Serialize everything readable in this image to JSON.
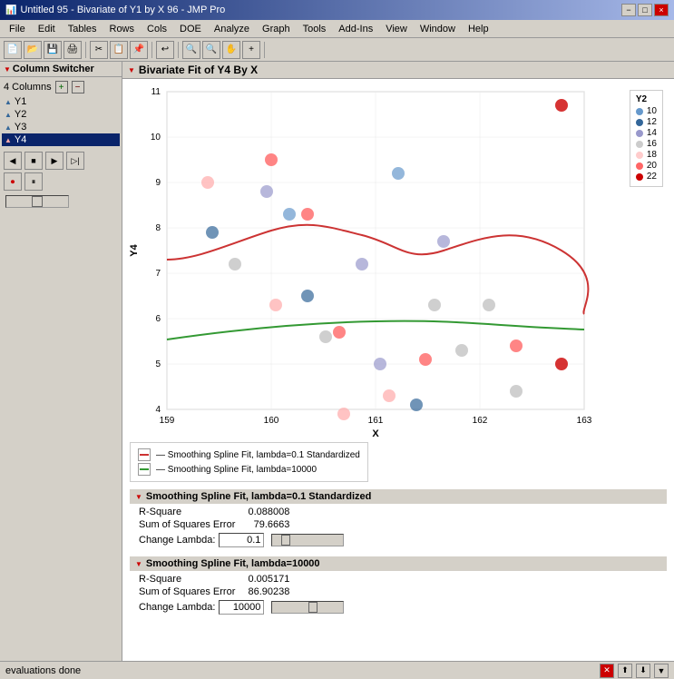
{
  "titleBar": {
    "title": "Untitled 95 - Bivariate of Y1 by X 96 - JMP Pro",
    "minBtn": "−",
    "maxBtn": "□",
    "closeBtn": "×"
  },
  "menuBar": {
    "items": [
      "File",
      "Edit",
      "Tables",
      "Rows",
      "Cols",
      "DOE",
      "Analyze",
      "Graph",
      "Tools",
      "Add-Ins",
      "View",
      "Window",
      "Help"
    ]
  },
  "leftPanel": {
    "header": "Column Switcher",
    "columnCount": "4 Columns",
    "addBtn": "+",
    "removeBtn": "−",
    "columns": [
      {
        "name": "Y1",
        "type": "numeric"
      },
      {
        "name": "Y2",
        "type": "numeric"
      },
      {
        "name": "Y3",
        "type": "numeric"
      },
      {
        "name": "Y4",
        "type": "numeric",
        "selected": true
      }
    ]
  },
  "chartHeader": "Bivariate Fit of Y4 By X",
  "chart": {
    "xLabel": "X",
    "yLabel": "Y4",
    "xMin": 159,
    "xMax": 163,
    "yMin": 4,
    "yMax": 11,
    "xTicks": [
      159,
      160,
      161,
      162,
      163
    ],
    "yTicks": [
      4,
      5,
      6,
      7,
      8,
      9,
      10,
      11
    ]
  },
  "legend": {
    "title": "Y2",
    "items": [
      {
        "label": "10",
        "color": "#6699cc"
      },
      {
        "label": "12",
        "color": "#336699"
      },
      {
        "label": "14",
        "color": "#9999cc"
      },
      {
        "label": "16",
        "color": "#cccccc"
      },
      {
        "label": "18",
        "color": "#ffcccc"
      },
      {
        "label": "20",
        "color": "#ff6666"
      },
      {
        "label": "22",
        "color": "#cc0000"
      }
    ]
  },
  "fitLegend": {
    "items": [
      {
        "label": "Smoothing Spline Fit, lambda=0.1 Standardized",
        "color": "#cc3333"
      },
      {
        "label": "Smoothing Spline Fit, lambda=10000",
        "color": "#339933"
      }
    ]
  },
  "spline1": {
    "header": "Smoothing Spline Fit, lambda=0.1 Standardized",
    "rSquareLabel": "R-Square",
    "rSquareValue": "0.088008",
    "ssErrorLabel": "Sum of Squares Error",
    "ssErrorValue": "79.6663",
    "changeLambdaLabel": "Change Lambda:",
    "lambdaValue": "0.1"
  },
  "spline2": {
    "header": "Smoothing Spline Fit, lambda=10000",
    "rSquareLabel": "R-Square",
    "rSquareValue": "0.005171",
    "ssErrorLabel": "Sum of Squares Error",
    "ssErrorValue": "86.90238",
    "changeLambdaLabel": "Change Lambda:",
    "lambdaValue": "10000"
  },
  "statusBar": {
    "text": "evaluations done"
  }
}
